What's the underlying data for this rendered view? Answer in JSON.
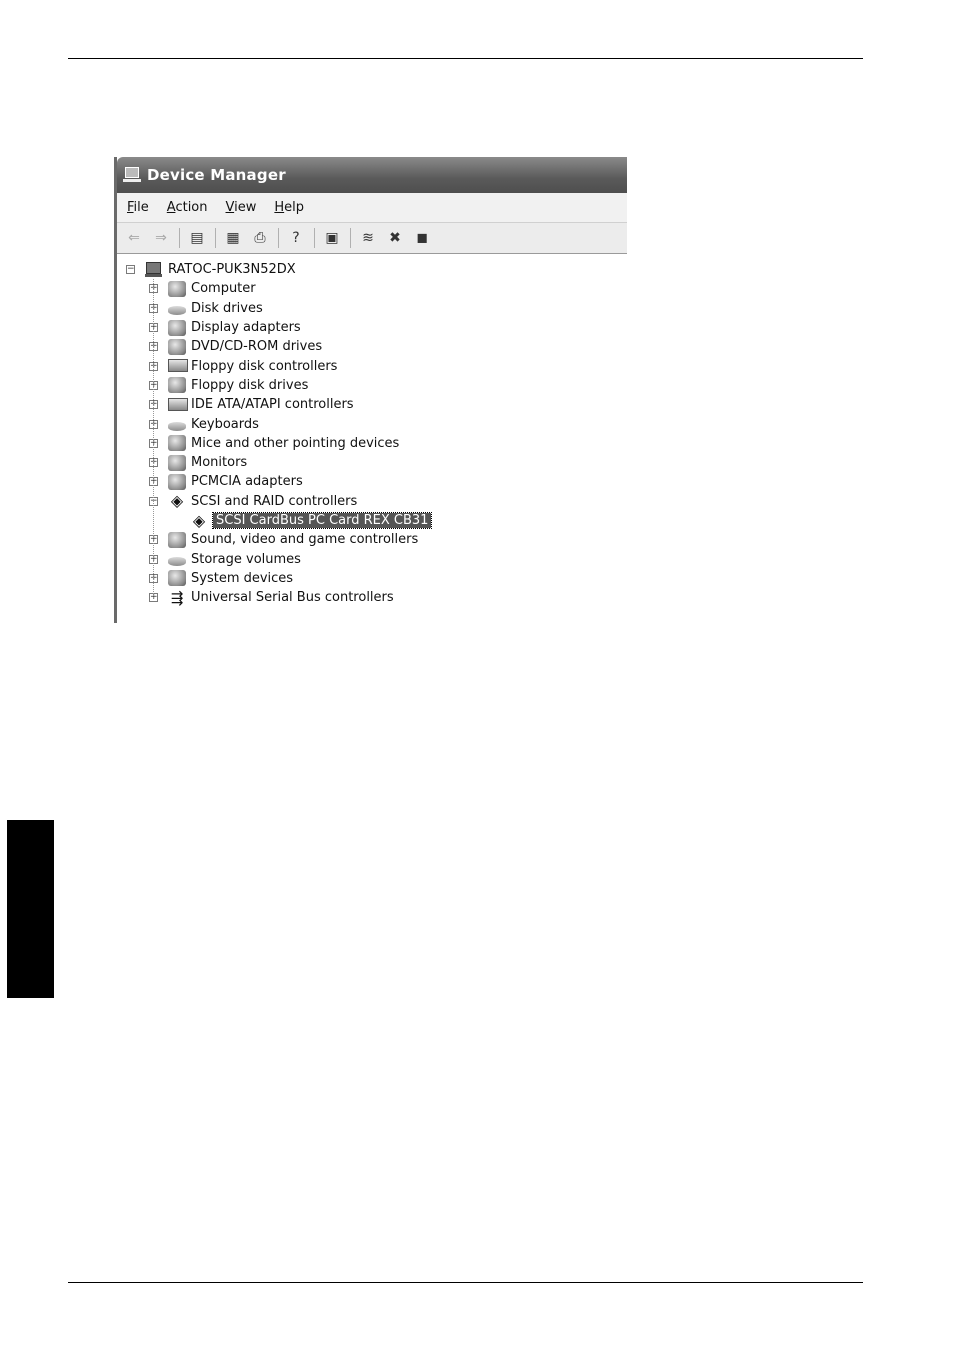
{
  "window": {
    "title": "Device Manager"
  },
  "menu": [
    {
      "label_rest": "ile",
      "accel": "F"
    },
    {
      "label_rest": "ction",
      "accel": "A"
    },
    {
      "label_rest": "iew",
      "accel": "V"
    },
    {
      "label_rest": "elp",
      "accel": "H"
    }
  ],
  "toolbar": [
    {
      "name": "back-arrow-icon",
      "glyph": "⇐",
      "disabled": true
    },
    {
      "name": "forward-arrow-icon",
      "glyph": "⇒",
      "disabled": true
    },
    {
      "sep": true
    },
    {
      "name": "show-hide-console-tree-icon",
      "glyph": "▤"
    },
    {
      "sep": true
    },
    {
      "name": "properties-icon",
      "glyph": "▦"
    },
    {
      "name": "print-icon",
      "glyph": "⎙"
    },
    {
      "sep": true
    },
    {
      "name": "help-icon",
      "glyph": "?"
    },
    {
      "sep": true
    },
    {
      "name": "scan-hardware-icon",
      "glyph": "▣"
    },
    {
      "sep": true
    },
    {
      "name": "update-driver-icon",
      "glyph": "≋"
    },
    {
      "name": "uninstall-icon",
      "glyph": "✖"
    },
    {
      "name": "disable-icon",
      "glyph": "◼"
    }
  ],
  "tree": {
    "root": "RATOC-PUK3N52DX",
    "categories": [
      {
        "label": "Computer",
        "icon": "computer-icon"
      },
      {
        "label": "Disk drives",
        "icon": "disk-drive-icon"
      },
      {
        "label": "Display adapters",
        "icon": "display-adapter-icon"
      },
      {
        "label": "DVD/CD-ROM drives",
        "icon": "dvd-drive-icon"
      },
      {
        "label": "Floppy disk controllers",
        "icon": "floppy-controller-icon"
      },
      {
        "label": "Floppy disk drives",
        "icon": "floppy-drive-icon"
      },
      {
        "label": "IDE ATA/ATAPI controllers",
        "icon": "ide-controller-icon"
      },
      {
        "label": "Keyboards",
        "icon": "keyboard-icon"
      },
      {
        "label": "Mice and other pointing devices",
        "icon": "mouse-icon"
      },
      {
        "label": "Monitors",
        "icon": "monitor-icon"
      },
      {
        "label": "PCMCIA adapters",
        "icon": "pcmcia-icon"
      },
      {
        "label": "SCSI and RAID controllers",
        "icon": "scsi-icon",
        "expanded": true,
        "children": [
          {
            "label": "SCSI CardBus PC Card REX CB31",
            "icon": "scsi-device-icon",
            "selected": true
          }
        ]
      },
      {
        "label": "Sound, video and game controllers",
        "icon": "sound-icon"
      },
      {
        "label": "Storage volumes",
        "icon": "storage-volume-icon"
      },
      {
        "label": "System devices",
        "icon": "system-device-icon"
      },
      {
        "label": "Universal Serial Bus controllers",
        "icon": "usb-icon"
      }
    ]
  }
}
